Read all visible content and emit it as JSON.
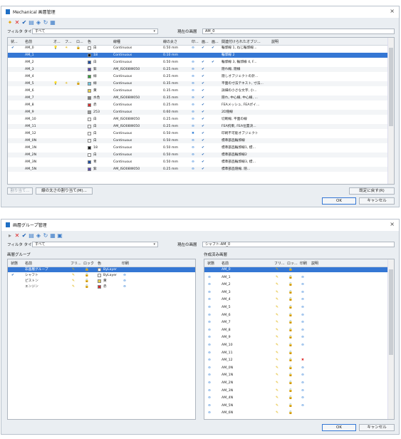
{
  "win1": {
    "title": "Mechanical 画層管理",
    "close": "×",
    "filter_label": "フィルタ タイプ",
    "filter_value": "すべて",
    "current_layer_label": "現在の画層",
    "current_layer_value": "AM_0",
    "headers": [
      "状...",
      "名前",
      "オ...",
      "フ...",
      "ロ...",
      "色",
      "線種",
      "線の太さ",
      "印...",
      "画...",
      "画...",
      "関連付けられたオブジ...",
      "説明"
    ],
    "rows": [
      {
        "status": "✔",
        "name": "AM_0",
        "on": "💡",
        "freeze": "☀",
        "lock": "🔓",
        "color_hex": "#ffffff",
        "color": "白",
        "ltype": "Continuous",
        "lw": "0.50 mm",
        "plot": "⊖",
        "c1": "✔",
        "c2": "✔",
        "assoc": "輪郭線 1, ねじ輪郭線...",
        "desc": ""
      },
      {
        "status": "",
        "name": "AM_1",
        "on": "",
        "freeze": "",
        "lock": "",
        "color_hex": "#1c1c1c",
        "color": "18",
        "ltype": "Continuous",
        "lw": "0.10 mm",
        "plot": "⊖",
        "c1": "",
        "c2": "",
        "assoc": "輪郭線 2",
        "desc": ""
      },
      {
        "status": "",
        "name": "AM_2",
        "on": "",
        "freeze": "",
        "lock": "",
        "color_hex": "#1f4fa0",
        "color": "白",
        "ltype": "Continuous",
        "lw": "0.50 mm",
        "plot": "⊖",
        "c1": "✔",
        "c2": "✔",
        "assoc": "輪郭線 3, 輪郭線 4, F...",
        "desc": ""
      },
      {
        "status": "",
        "name": "AM_3",
        "on": "",
        "freeze": "",
        "lock": "",
        "color_hex": "#5a4ab0",
        "color": "紫",
        "ltype": "AM_ISO08W050",
        "lw": "0.25 mm",
        "plot": "⊖",
        "c1": "✔",
        "c2": "",
        "assoc": "隠れ線, 隠線",
        "desc": ""
      },
      {
        "status": "",
        "name": "AM_4",
        "on": "",
        "freeze": "",
        "lock": "",
        "color_hex": "#3aa040",
        "color": "緑",
        "ltype": "Continuous",
        "lw": "0.25 mm",
        "plot": "⊖",
        "c1": "✔",
        "c2": "",
        "assoc": "隠しオブジェクトの針...",
        "desc": ""
      },
      {
        "status": "",
        "name": "AM_5",
        "on": "💡",
        "freeze": "☀",
        "lock": "🔓",
        "color_hex": "#6ec8e0",
        "color": "緑",
        "ltype": "Continuous",
        "lw": "0.35 mm",
        "plot": "⊖",
        "c1": "✔",
        "c2": "",
        "assoc": "平面の寸法テキスト, 寸法...",
        "desc": ""
      },
      {
        "status": "",
        "name": "AM_6",
        "on": "",
        "freeze": "",
        "lock": "",
        "color_hex": "#e8d048",
        "color": "黄",
        "ltype": "Continuous",
        "lw": "0.35 mm",
        "plot": "⊖",
        "c1": "✔",
        "c2": "",
        "assoc": "詳細の小さな文字, 小...",
        "desc": ""
      },
      {
        "status": "",
        "name": "AM_7",
        "on": "",
        "freeze": "",
        "lock": "",
        "color_hex": "#808080",
        "color": "水色",
        "ltype": "AM_ISO08W050",
        "lw": "0.35 mm",
        "plot": "⊖",
        "c1": "✔",
        "c2": "",
        "assoc": "隠れ, 中心線, 中心線, ...",
        "desc": ""
      },
      {
        "status": "",
        "name": "AM_8",
        "on": "",
        "freeze": "",
        "lock": "",
        "color_hex": "#d43030",
        "color": "赤",
        "ltype": "Continuous",
        "lw": "0.25 mm",
        "plot": "⊖",
        "c1": "✔",
        "c2": "",
        "assoc": "FEAメッシュ, FEAポイ...",
        "desc": ""
      },
      {
        "status": "",
        "name": "AM_9",
        "on": "",
        "freeze": "",
        "lock": "",
        "color_hex": "#9a9a9a",
        "color": "253",
        "ltype": "Continuous",
        "lw": "0.60 mm",
        "plot": "⊖",
        "c1": "✔",
        "c2": "",
        "assoc": "2D隠線",
        "desc": ""
      },
      {
        "status": "",
        "name": "AM_10",
        "on": "",
        "freeze": "",
        "lock": "",
        "color_hex": "#ffffff",
        "color": "白",
        "ltype": "AM_ISO08W050",
        "lw": "0.25 mm",
        "plot": "⊖",
        "c1": "✔",
        "c2": "",
        "assoc": "切断線, 平面の線",
        "desc": ""
      },
      {
        "status": "",
        "name": "AM_11",
        "on": "",
        "freeze": "",
        "lock": "",
        "color_hex": "#ffffff",
        "color": "白",
        "ltype": "AM_ISO08W050",
        "lw": "0.25 mm",
        "plot": "⊖",
        "c1": "✔",
        "c2": "",
        "assoc": "FEA拘束, FEA位置決...",
        "desc": ""
      },
      {
        "status": "",
        "name": "AM_12",
        "on": "",
        "freeze": "",
        "lock": "",
        "color_hex": "#ffffff",
        "color": "白",
        "ltype": "Continuous",
        "lw": "0.50 mm",
        "plot": "✖",
        "c1": "✔",
        "c2": "",
        "assoc": "印刷不可能オブジェクト",
        "desc": ""
      },
      {
        "status": "",
        "name": "AM_0N",
        "on": "",
        "freeze": "",
        "lock": "",
        "color_hex": "#ffffff",
        "color": "白",
        "ltype": "Continuous",
        "lw": "0.50 mm",
        "plot": "⊖",
        "c1": "✔",
        "c2": "",
        "assoc": "標準部品輪郭線",
        "desc": ""
      },
      {
        "status": "",
        "name": "AM_1N",
        "on": "",
        "freeze": "",
        "lock": "",
        "color_hex": "#1c1c1c",
        "color": "18",
        "ltype": "Continuous",
        "lw": "0.50 mm",
        "plot": "⊖",
        "c1": "✔",
        "c2": "",
        "assoc": "標準部品輪郭線1, 標...",
        "desc": ""
      },
      {
        "status": "",
        "name": "AM_2N",
        "on": "",
        "freeze": "",
        "lock": "",
        "color_hex": "#ffffff",
        "color": "白",
        "ltype": "Continuous",
        "lw": "0.50 mm",
        "plot": "⊖",
        "c1": "✔",
        "c2": "",
        "assoc": "標準部品輪郭線2",
        "desc": ""
      },
      {
        "status": "",
        "name": "AM_3N",
        "on": "",
        "freeze": "",
        "lock": "",
        "color_hex": "#1f4fa0",
        "color": "青",
        "ltype": "Continuous",
        "lw": "0.50 mm",
        "plot": "⊖",
        "c1": "✔",
        "c2": "",
        "assoc": "標準部品輪郭線3, 標...",
        "desc": ""
      },
      {
        "status": "",
        "name": "AM_5N",
        "on": "",
        "freeze": "",
        "lock": "",
        "color_hex": "#5a4ab0",
        "color": "紫",
        "ltype": "AM_ISO08W050",
        "lw": "0.25 mm",
        "plot": "⊖",
        "c1": "✔",
        "c2": "",
        "assoc": "標準部品隠線, 隠...",
        "desc": ""
      }
    ],
    "btn_assign": "線の太さの割り当て(M)...",
    "btn_disabled": "割り当て...",
    "btn_default": "既定に戻す(R)",
    "btn_ok": "OK",
    "btn_cancel": "キャンセル"
  },
  "win2": {
    "title": "画層グループ管理",
    "close": "×",
    "filter_label": "フィルタ タイプ",
    "filter_value": "すべて",
    "current_layer_label": "現在の画層",
    "current_layer_value": "シャフト-AM_0",
    "left_panel_label": "画層グループ",
    "right_panel_label": "作成済み画層",
    "left_headers": [
      "状態",
      "名前",
      "フリ...",
      "ロック",
      "色",
      "印刷"
    ],
    "left_rows": [
      {
        "status": "",
        "name": "非画層グループ",
        "color_hex": "#ffffff",
        "color": "ByLayer",
        "sel": true
      },
      {
        "status": "✔",
        "name": "シャフト",
        "color_hex": "#ffffff",
        "color": "ByLayer",
        "sel": false
      },
      {
        "status": "",
        "name": "ピストン",
        "color_hex": "#e8d048",
        "color": "黄",
        "sel": false
      },
      {
        "status": "",
        "name": "エンジン",
        "color_hex": "#d43030",
        "color": "赤",
        "sel": false
      }
    ],
    "right_headers": [
      "状態",
      "名前",
      "フリ...",
      "ロッ...",
      "印刷",
      "説明"
    ],
    "right_rows": [
      {
        "name": "AM_0",
        "sel": true,
        "plot": "⊖"
      },
      {
        "name": "AM_1",
        "sel": false,
        "plot": "⊖"
      },
      {
        "name": "AM_2",
        "sel": false,
        "plot": "⊖"
      },
      {
        "name": "AM_3",
        "sel": false,
        "plot": "⊖"
      },
      {
        "name": "AM_4",
        "sel": false,
        "plot": "⊖"
      },
      {
        "name": "AM_5",
        "sel": false,
        "plot": "⊖"
      },
      {
        "name": "AM_6",
        "sel": false,
        "plot": "⊖"
      },
      {
        "name": "AM_7",
        "sel": false,
        "plot": "⊖"
      },
      {
        "name": "AM_8",
        "sel": false,
        "plot": "⊖"
      },
      {
        "name": "AM_9",
        "sel": false,
        "plot": "⊖"
      },
      {
        "name": "AM_10",
        "sel": false,
        "plot": "⊖"
      },
      {
        "name": "AM_11",
        "sel": false,
        "plot": ""
      },
      {
        "name": "AM_12",
        "sel": false,
        "plot": "✖"
      },
      {
        "name": "AM_0N",
        "sel": false,
        "plot": "⊖"
      },
      {
        "name": "AM_1N",
        "sel": false,
        "plot": "⊖"
      },
      {
        "name": "AM_2N",
        "sel": false,
        "plot": "⊖"
      },
      {
        "name": "AM_3N",
        "sel": false,
        "plot": "⊖"
      },
      {
        "name": "AM_4N",
        "sel": false,
        "plot": "⊖"
      },
      {
        "name": "AM_5N",
        "sel": false,
        "plot": "⊖"
      },
      {
        "name": "AM_6N",
        "sel": false,
        "plot": ""
      }
    ],
    "btn_ok": "OK",
    "btn_cancel": "キャンセル"
  }
}
